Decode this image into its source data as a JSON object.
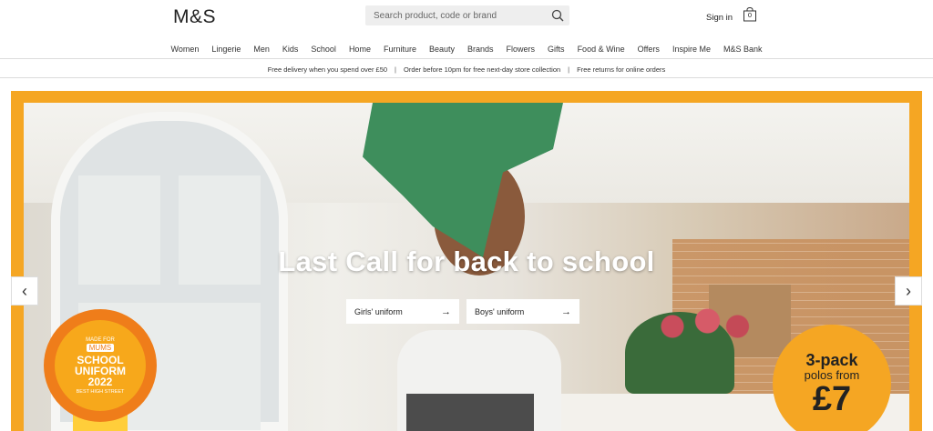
{
  "header": {
    "logo": "M&S",
    "search_placeholder": "Search product, code or brand",
    "sign_in": "Sign in",
    "bag_count": "0"
  },
  "nav": {
    "items": [
      "Women",
      "Lingerie",
      "Men",
      "Kids",
      "School",
      "Home",
      "Furniture",
      "Beauty",
      "Brands",
      "Flowers",
      "Gifts",
      "Food & Wine",
      "Offers",
      "Inspire Me",
      "M&S Bank"
    ]
  },
  "promo": {
    "items": [
      "Free delivery when you spend over £50",
      "Order before 10pm for free next-day store collection",
      "Free returns for online orders"
    ],
    "separator": "|"
  },
  "hero": {
    "headline": "Last Call for back to school",
    "cta_girls": "Girls' uniform",
    "cta_boys": "Boys' uniform",
    "arrow": "→",
    "prev": "‹",
    "next": "›",
    "frame_color": "#f5a623"
  },
  "badge": {
    "made_for": "MADE FOR",
    "mums": "MUMS",
    "line1": "SCHOOL",
    "line2": "UNIFORM",
    "line3": "2022",
    "sub": "BEST HIGH STREET"
  },
  "price": {
    "line1": "3-pack",
    "line2": "polos from",
    "line3": "£7"
  }
}
